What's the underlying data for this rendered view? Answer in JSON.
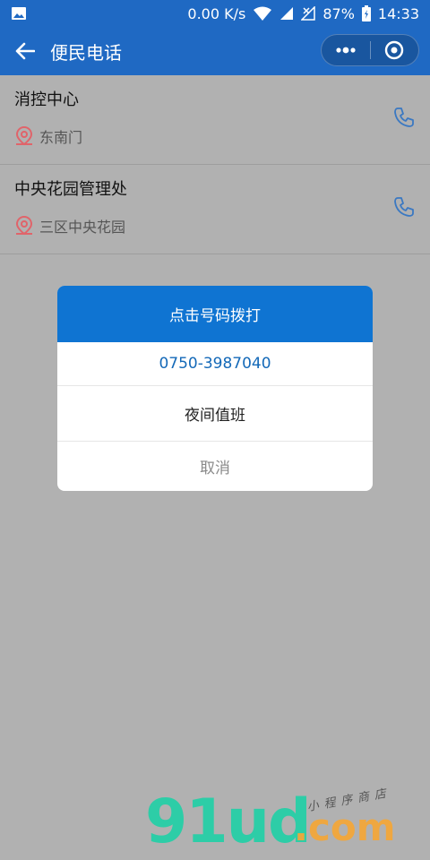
{
  "status_bar": {
    "speed": "0.00 K/s",
    "battery": "87%",
    "time": "14:33"
  },
  "nav": {
    "title": "便民电话"
  },
  "contacts": [
    {
      "name": "消控中心",
      "location": "东南门"
    },
    {
      "name": "中央花园管理处",
      "location": "三区中央花园"
    }
  ],
  "dialog": {
    "title": "点击号码拨打",
    "phone": "0750-3987040",
    "label": "夜间值班",
    "cancel": "取消"
  },
  "watermark": {
    "main": "91ud",
    "domain": ".com",
    "tagline": "小程序商店"
  },
  "colors": {
    "nav": "#1f69c3",
    "dialog_header": "#0f74d2",
    "phone_text": "#1469b8",
    "location_icon": "#e0646a",
    "phone_icon": "#3a78c2"
  }
}
